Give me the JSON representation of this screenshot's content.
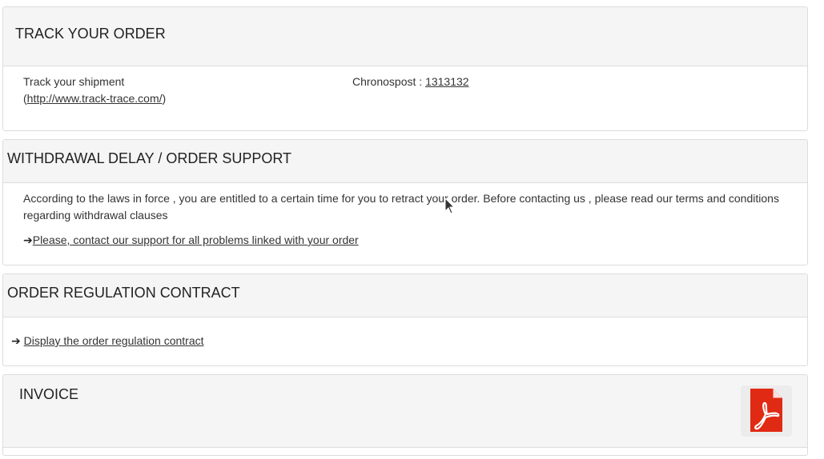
{
  "track_order": {
    "title": "TRACK YOUR ORDER",
    "shipment_label": "Track your shipment",
    "open_paren": "(",
    "tracking_site_link": "http://www.track-trace.com/",
    "close_paren": ")",
    "carrier_label": "Chronospost : ",
    "tracking_number": "1313132"
  },
  "withdrawal": {
    "title": "WITHDRAWAL DELAY / ORDER SUPPORT",
    "text_line1": "According to the laws in force , you are entitled to a certain time for you to retract your order. Before contacting us , please read our terms and conditions",
    "text_line2": "regarding withdrawal clauses",
    "support_link": "Please, contact our support for all problems linked with your order"
  },
  "regulation": {
    "title": "ORDER REGULATION CONTRACT",
    "contract_link": "Display the order regulation contract"
  },
  "invoice": {
    "title": "INVOICE",
    "pdf_icon": "pdf-file-icon"
  },
  "icons": {
    "arrow": "arrow-right-icon",
    "cursor": "mouse-pointer-icon"
  },
  "colors": {
    "panel_header_bg": "#f5f5f5",
    "panel_border": "#dcdcdc",
    "pdf_red": "#e02a13"
  }
}
